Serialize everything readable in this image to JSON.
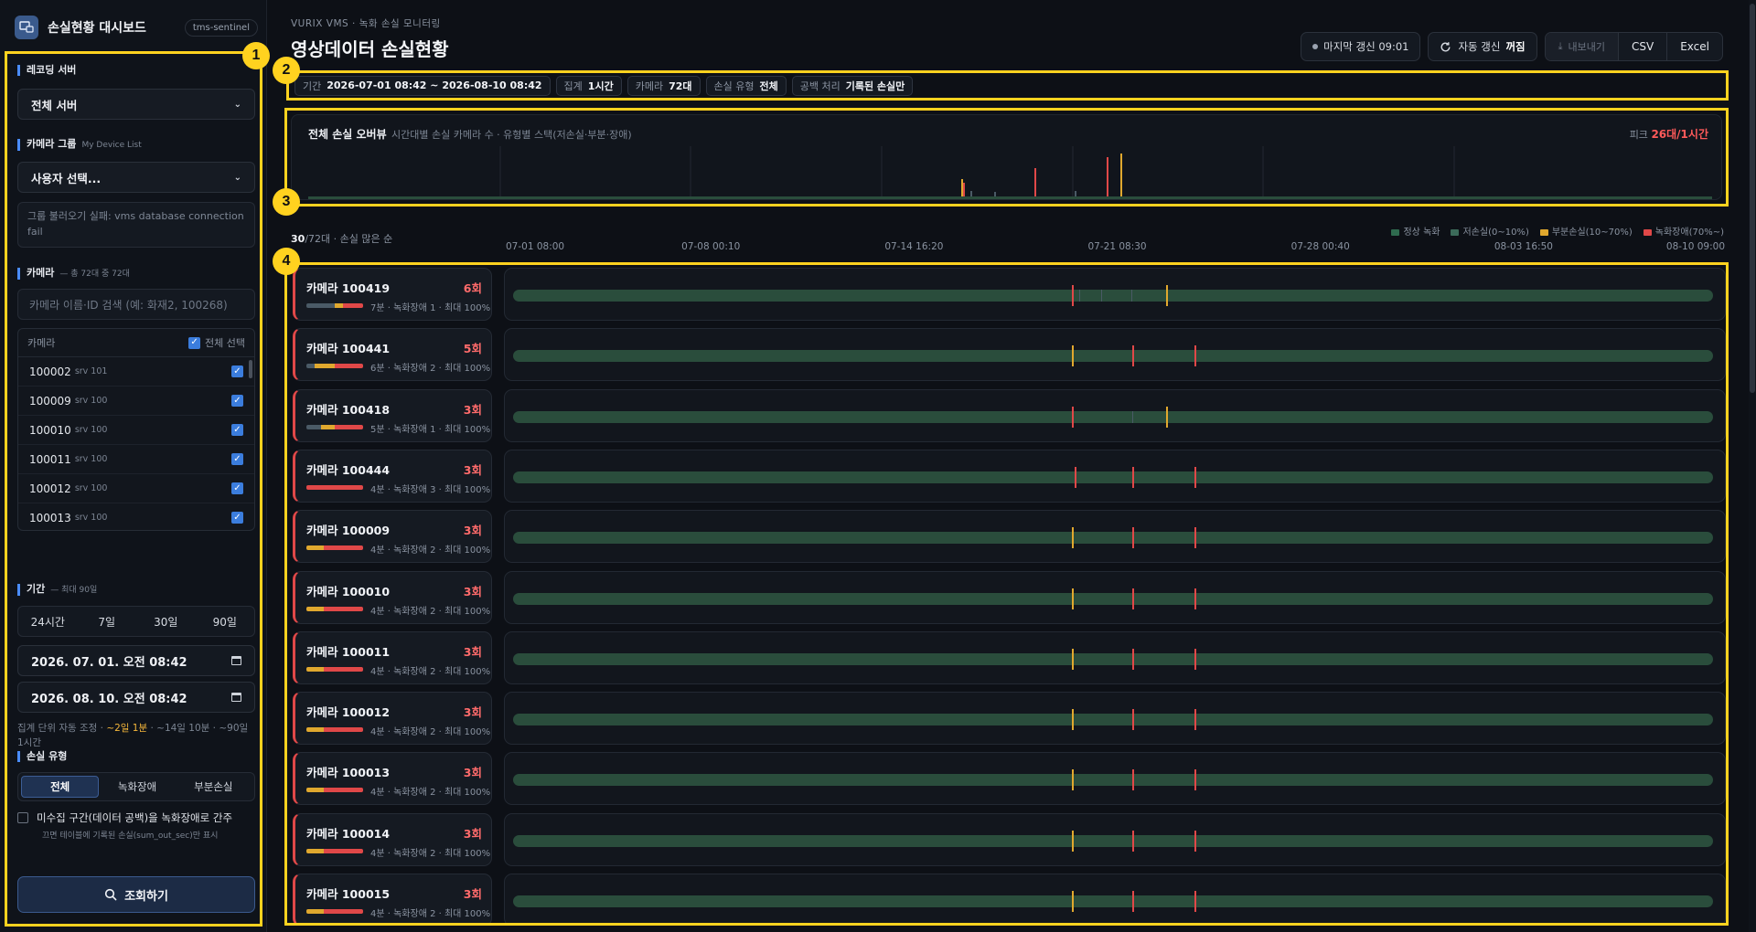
{
  "sidebar": {
    "brand_title": "손실현황 대시보드",
    "brand_badge": "tms-sentinel",
    "recording_server_label": "레코딩 서버",
    "recording_server_value": "전체 서버",
    "camera_group_label": "카메라 그룹",
    "camera_group_sub": "My Device List",
    "camera_group_value": "사용자 선택...",
    "group_error": "그룹 불러오기 실패: vms database connection fail",
    "camera_label": "카메라",
    "camera_sub": "— 총 72대 중 72대",
    "camera_search_placeholder": "카메라 이름·ID 검색 (예: 화재2, 100268)",
    "camera_table_header": "카메라",
    "select_all_label": "전체 선택",
    "cameras": [
      {
        "id": "100002",
        "srv": "srv 101"
      },
      {
        "id": "100009",
        "srv": "srv 100"
      },
      {
        "id": "100010",
        "srv": "srv 100"
      },
      {
        "id": "100011",
        "srv": "srv 100"
      },
      {
        "id": "100012",
        "srv": "srv 100"
      },
      {
        "id": "100013",
        "srv": "srv 100"
      }
    ],
    "period_label": "기간",
    "period_sub": "— 최대 90일",
    "period_presets": [
      "24시간",
      "7일",
      "30일",
      "90일"
    ],
    "start_date": "2026. 07. 01. 오전 08:42",
    "end_date": "2026. 08. 10. 오전 08:42",
    "agg_note_prefix": "집계 단위 자동 조정 · ",
    "agg_note_highlight": "~2일 1분",
    "agg_note_suffix": " · ~14일 10분 · ~90일 1시간",
    "loss_type_label": "손실 유형",
    "loss_types": [
      "전체",
      "녹화장애",
      "부분손실"
    ],
    "gap_checkbox_label": "미수집 구간(데이터 공백)을 녹화장애로 간주",
    "gap_checkbox_note": "끄면 테이블에 기록된 손실(sum_out_sec)만 표시",
    "query_button": "조회하기"
  },
  "header": {
    "eyebrow": "VURIX VMS · 녹화 손실 모니터링",
    "title": "영상데이터 손실현황",
    "last_refresh": "마지막 갱신 09:01",
    "auto_refresh_label": "자동 갱신",
    "auto_refresh_state": "꺼짐",
    "export_label": "내보내기",
    "csv_label": "CSV",
    "excel_label": "Excel"
  },
  "filters": [
    {
      "key": "기간",
      "value": "2026-07-01 08:42 ~ 2026-08-10 08:42"
    },
    {
      "key": "집계",
      "value": "1시간"
    },
    {
      "key": "카메라",
      "value": "72대"
    },
    {
      "key": "손실 유형",
      "value": "전체"
    },
    {
      "key": "공백 처리",
      "value": "기록된 손실만"
    }
  ],
  "overview": {
    "title": "전체 손실 오버뷰",
    "subtitle": "시간대별 손실 카메라 수 · 유형별 스택(저손실·부분·장애)",
    "peak_label": "피크",
    "peak_value": "26대/1시간"
  },
  "list_meta": {
    "shown": "30",
    "rest": "/72대 · 손실 많은 순"
  },
  "legend": [
    {
      "label": "정상 녹화",
      "color": "#2f6b4f"
    },
    {
      "label": "저손실(0~10%)",
      "color": "#3c6b5a"
    },
    {
      "label": "부분손실(10~70%)",
      "color": "#e0a82e"
    },
    {
      "label": "녹화장애(70%~)",
      "color": "#e04848"
    }
  ],
  "axis": [
    "07-01 08:00",
    "07-08 00:10",
    "07-14 16:20",
    "07-21 08:30",
    "07-28 00:40",
    "08-03 16:50",
    "08-10 09:00"
  ],
  "colors": {
    "normal": "#2a4d3c",
    "low": "#4a5a66",
    "partial": "#e0a82e",
    "fail": "#e04848",
    "accent": "#ffd21f"
  },
  "camera_rows": [
    {
      "name": "카메라 100419",
      "count": "6회",
      "detail": "7분 · 녹화장애 1 · 최대 100%"
    },
    {
      "name": "카메라 100441",
      "count": "5회",
      "detail": "6분 · 녹화장애 2 · 최대 100%"
    },
    {
      "name": "카메라 100418",
      "count": "3회",
      "detail": "5분 · 녹화장애 1 · 최대 100%"
    },
    {
      "name": "카메라 100444",
      "count": "3회",
      "detail": "4분 · 녹화장애 3 · 최대 100%"
    },
    {
      "name": "카메라 100009",
      "count": "3회",
      "detail": "4분 · 녹화장애 2 · 최대 100%"
    },
    {
      "name": "카메라 100010",
      "count": "3회",
      "detail": "4분 · 녹화장애 2 · 최대 100%"
    },
    {
      "name": "카메라 100011",
      "count": "3회",
      "detail": "4분 · 녹화장애 2 · 최대 100%"
    },
    {
      "name": "카메라 100012",
      "count": "3회",
      "detail": "4분 · 녹화장애 2 · 최대 100%"
    },
    {
      "name": "카메라 100013",
      "count": "3회",
      "detail": "4분 · 녹화장애 2 · 최대 100%"
    },
    {
      "name": "카메라 100014",
      "count": "3회",
      "detail": "4분 · 녹화장애 2 · 최대 100%"
    },
    {
      "name": "카메라 100015",
      "count": "3회",
      "detail": "4분 · 녹화장애 2 · 최대 100%"
    }
  ],
  "badges": [
    "1",
    "2",
    "3",
    "4"
  ]
}
